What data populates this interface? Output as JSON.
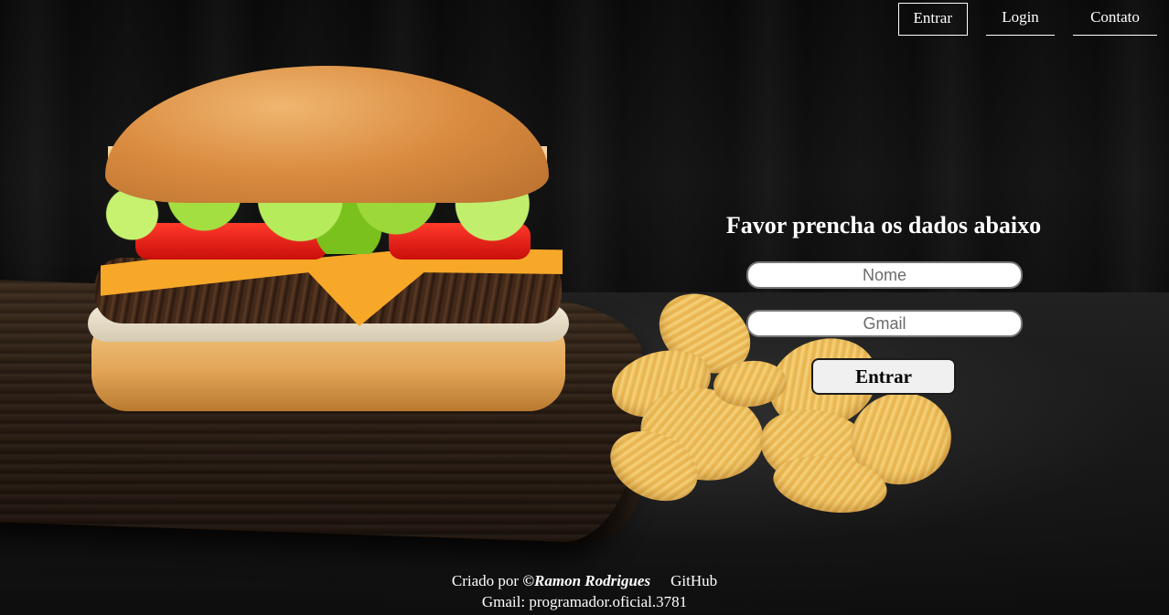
{
  "nav": {
    "items": [
      {
        "label": "Entrar"
      },
      {
        "label": "Login"
      },
      {
        "label": "Contato"
      }
    ]
  },
  "form": {
    "title": "Favor prencha os dados abaixo",
    "nome_placeholder": "Nome",
    "gmail_placeholder": "Gmail",
    "submit_label": "Entrar"
  },
  "footer": {
    "created_by": "Criado por ",
    "author": "©Ramon Rodrigues",
    "github": "GitHub",
    "gmail": "Gmail: programador.oficial.3781"
  }
}
